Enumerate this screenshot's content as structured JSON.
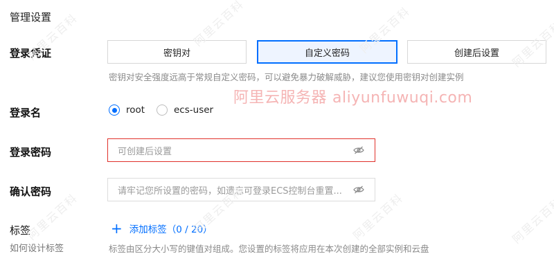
{
  "section_title": "管理设置",
  "login_credential": {
    "label": "登录凭证",
    "options": [
      "密钥对",
      "自定义密码",
      "创建后设置"
    ],
    "selected": "自定义密码",
    "hint": "密钥对安全强度远高于常规自定义密码，可以避免暴力破解威胁，建议您使用密钥对创建实例"
  },
  "watermark_banner": {
    "zh": "阿里云服务器",
    "en": "aliyunfuwuqi.com"
  },
  "watermark_repeat": "阿里云百科",
  "login_name": {
    "label": "登录名",
    "options": [
      "root",
      "ecs-user"
    ],
    "selected": "root"
  },
  "login_password": {
    "label": "登录密码",
    "placeholder": "可创建后设置",
    "state": "error"
  },
  "confirm_password": {
    "label": "确认密码",
    "placeholder": "请牢记您所设置的密码，如遗忘可登录ECS控制台重置..."
  },
  "tags": {
    "label": "标签",
    "sublabel": "如何设计标签",
    "add_label": "添加标签",
    "count": "（0 / 20）",
    "hint": "标签由区分大小写的键值对组成。您设置的标签将应用在本次创建的全部实例和云盘"
  },
  "colors": {
    "accent": "#006eff",
    "error": "#e0302a",
    "watermark_banner": "#f5b4b4"
  },
  "icons": {
    "eye_off": "eye-off-icon",
    "plus": "plus-icon"
  }
}
